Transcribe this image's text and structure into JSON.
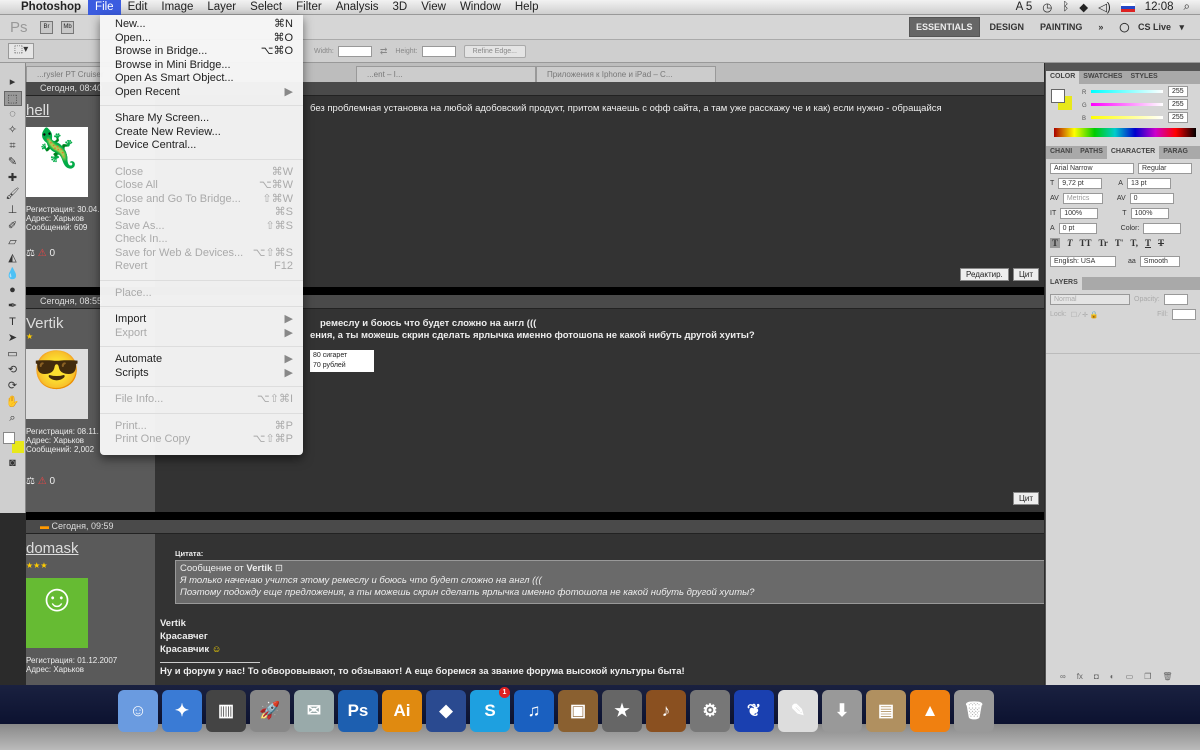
{
  "menubar": {
    "apple": "",
    "app": "Photoshop",
    "items": [
      "File",
      "Edit",
      "Image",
      "Layer",
      "Select",
      "Filter",
      "Analysis",
      "3D",
      "View",
      "Window",
      "Help"
    ],
    "status": {
      "adobe": "5",
      "time": "12:08"
    }
  },
  "appbar": {
    "ps": "Ps",
    "br": "Br",
    "mb": "Mb",
    "workspaces": [
      "ESSENTIALS",
      "DESIGN",
      "PAINTING"
    ],
    "more": "»",
    "cslive": "CS Live"
  },
  "options": {
    "width_label": "Width:",
    "height_label": "Height:",
    "refine": "Refine Edge..."
  },
  "tabs": [
    "...rysler PT Cruiser",
    "...ent – I...",
    "Приложения к Iphone и iPad – C..."
  ],
  "file_menu": [
    {
      "label": "New...",
      "shortcut": "⌘N",
      "enabled": true
    },
    {
      "label": "Open...",
      "shortcut": "⌘O",
      "enabled": true
    },
    {
      "label": "Browse in Bridge...",
      "shortcut": "⌥⌘O",
      "enabled": true
    },
    {
      "label": "Browse in Mini Bridge...",
      "shortcut": "",
      "enabled": true
    },
    {
      "label": "Open As Smart Object...",
      "shortcut": "",
      "enabled": true
    },
    {
      "label": "Open Recent",
      "shortcut": "▶",
      "enabled": true
    },
    {
      "sep": true
    },
    {
      "label": "Share My Screen...",
      "shortcut": "",
      "enabled": true
    },
    {
      "label": "Create New Review...",
      "shortcut": "",
      "enabled": true
    },
    {
      "label": "Device Central...",
      "shortcut": "",
      "enabled": true
    },
    {
      "sep": true
    },
    {
      "label": "Close",
      "shortcut": "⌘W",
      "enabled": false
    },
    {
      "label": "Close All",
      "shortcut": "⌥⌘W",
      "enabled": false
    },
    {
      "label": "Close and Go To Bridge...",
      "shortcut": "⇧⌘W",
      "enabled": false
    },
    {
      "label": "Save",
      "shortcut": "⌘S",
      "enabled": false
    },
    {
      "label": "Save As...",
      "shortcut": "⇧⌘S",
      "enabled": false
    },
    {
      "label": "Check In...",
      "shortcut": "",
      "enabled": false
    },
    {
      "label": "Save for Web & Devices...",
      "shortcut": "⌥⇧⌘S",
      "enabled": false
    },
    {
      "label": "Revert",
      "shortcut": "F12",
      "enabled": false
    },
    {
      "sep": true
    },
    {
      "label": "Place...",
      "shortcut": "",
      "enabled": false
    },
    {
      "sep": true
    },
    {
      "label": "Import",
      "shortcut": "▶",
      "enabled": true
    },
    {
      "label": "Export",
      "shortcut": "▶",
      "enabled": false
    },
    {
      "sep": true
    },
    {
      "label": "Automate",
      "shortcut": "▶",
      "enabled": true
    },
    {
      "label": "Scripts",
      "shortcut": "▶",
      "enabled": true
    },
    {
      "sep": true
    },
    {
      "label": "File Info...",
      "shortcut": "⌥⇧⌘I",
      "enabled": false
    },
    {
      "sep": true
    },
    {
      "label": "Print...",
      "shortcut": "⌘P",
      "enabled": false
    },
    {
      "label": "Print One Copy",
      "shortcut": "⌥⇧⌘P",
      "enabled": false
    }
  ],
  "forum": {
    "post1": {
      "time": "Сегодня, 08:40",
      "user": "hell",
      "reg": "Регистрация: 30.04.",
      "addr": "Адрес: Харьков",
      "msgs": "Сообщений: 609",
      "text": "без проблемная установка на любой адобовский продукт, притом качаешь с офф сайта, а там уже расскажу че и как) если нужно - обращайся",
      "edit": "Редактир.",
      "quote": "Цит"
    },
    "post2": {
      "time": "Сегодня, 08:55",
      "user": "Vertik",
      "reg": "Регистрация: 08.11.",
      "addr": "Адрес: Харьков",
      "msgs": "Сообщений: 2,002",
      "line1": "ремеслу и боюсь что будет сложно на англ (((",
      "line2": "ения, а ты можешь скрин сделать ярлычка именно фотошопа не какой нибуть другой хуиты?",
      "ad1": "80 сигарет",
      "ad2": "70 рублей",
      "quote": "Цит"
    },
    "post3": {
      "time": "Сегодня, 09:59",
      "user": "domask",
      "stars": "★★★",
      "reg": "Регистрация: 01.12.2007",
      "addr": "Адрес: Харьков",
      "quote_label": "Цитата:",
      "quote_from": "Сообщение от",
      "quote_author": "Vertik",
      "quote_l1": "Я только наченаю учится этому ремеслу и боюсь что будет сложно на англ (((",
      "quote_l2": "Поэтому подожду еще предложения, а ты можешь скрин сделать ярлычка именно фотошопа не какой нибуть другой хуиты?",
      "reply": [
        "Vertik",
        "Красавчег",
        "Красавчик"
      ],
      "signature": "Ну и форум у нас! То обворовывают, то обзывают! А еще боремся за звание форума высокой культуры быта!"
    }
  },
  "color_panel": {
    "tabs": [
      "COLOR",
      "SWATCHES",
      "STYLES"
    ],
    "r": "255",
    "g": "255",
    "b": "255",
    "colors": {
      "fg": "#ffffff",
      "bg": "#e8e81a"
    }
  },
  "char_panel": {
    "tabs": [
      "CHANI",
      "PATHS",
      "CHARACTER",
      "PARAG"
    ],
    "font": "Arial Narrow",
    "style": "Regular",
    "size": "9,72 pt",
    "leading": "13 pt",
    "kerning": "Metrics",
    "tracking": "0",
    "vscale": "100%",
    "hscale": "100%",
    "baseline": "0 pt",
    "color_label": "Color:",
    "lang": "English: USA",
    "aa_label": "aa",
    "aa": "Smooth",
    "styles": [
      "T",
      "T",
      "TT",
      "Tr",
      "T'",
      "T,",
      "T",
      "T"
    ]
  },
  "layers_panel": {
    "title": "LAYERS",
    "blend": "Normal",
    "opacity_label": "Opacity:",
    "lock_label": "Lock:",
    "fill_label": "Fill:",
    "footer": [
      "∞",
      "fx",
      "◘",
      "◐",
      "▭",
      "❐",
      "🗑"
    ]
  },
  "dock": [
    {
      "name": "finder",
      "g": "☺",
      "c": "#6a9be0"
    },
    {
      "name": "safari",
      "g": "✦",
      "c": "#3a7bd5"
    },
    {
      "name": "mixer",
      "g": "▥",
      "c": "#444"
    },
    {
      "name": "launchpad",
      "g": "🚀",
      "c": "#888"
    },
    {
      "name": "mail",
      "g": "✉",
      "c": "#9aa"
    },
    {
      "name": "photoshop",
      "g": "Ps",
      "c": "#1d5fb0"
    },
    {
      "name": "illustrator",
      "g": "Ai",
      "c": "#e08a10"
    },
    {
      "name": "adium",
      "g": "◆",
      "c": "#2a4a90"
    },
    {
      "name": "skype",
      "g": "S",
      "c": "#1ea0e0",
      "badge": "1"
    },
    {
      "name": "itunes",
      "g": "♫",
      "c": "#1a60c0"
    },
    {
      "name": "iphoto",
      "g": "▣",
      "c": "#8a6030"
    },
    {
      "name": "imovie",
      "g": "★",
      "c": "#666"
    },
    {
      "name": "garageband",
      "g": "♪",
      "c": "#8a5020"
    },
    {
      "name": "system-preferences",
      "g": "⚙",
      "c": "#777"
    },
    {
      "name": "growl",
      "g": "❦",
      "c": "#1a40b0"
    },
    {
      "name": "textedit",
      "g": "✎",
      "c": "#ddd"
    },
    {
      "name": "downloads",
      "g": "⬇",
      "c": "#999"
    },
    {
      "name": "archive",
      "g": "▤",
      "c": "#b09060"
    },
    {
      "name": "vlc",
      "g": "▲",
      "c": "#f08010"
    },
    {
      "name": "trash",
      "g": "🗑",
      "c": "#999"
    }
  ]
}
